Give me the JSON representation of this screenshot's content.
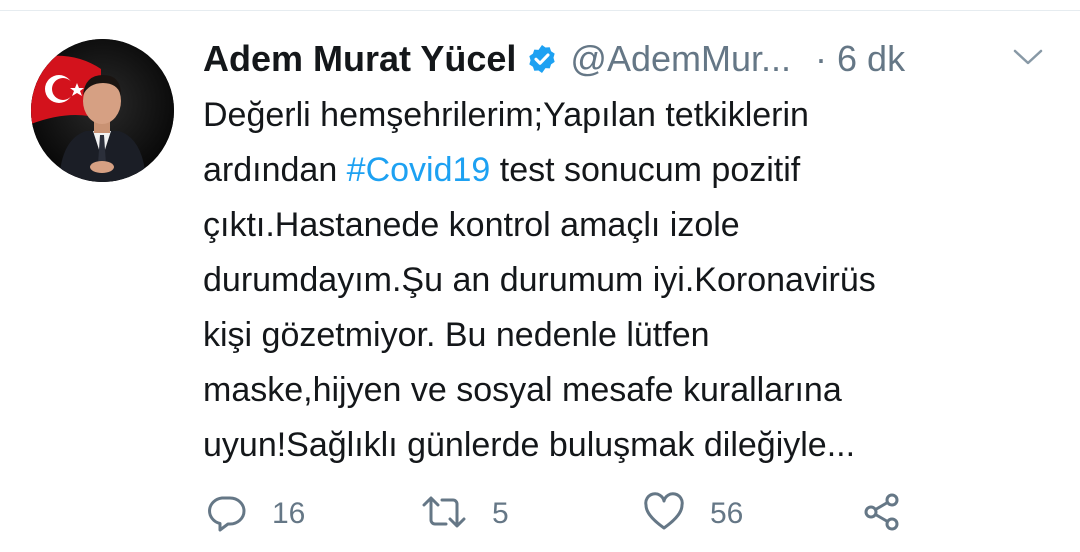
{
  "tweet": {
    "author_name": "Adem Murat Yücel",
    "handle": "@AdemMur...",
    "time": "· 6 dk",
    "verified_icon": "verified-badge-icon",
    "more_icon": "chevron-down-icon",
    "text_lines": [
      {
        "before": "Değerli hemşehrilerim;Yapılan tetkiklerin"
      },
      {
        "before": "ardından ",
        "hashtag": "#Covid19",
        "after": " test sonucum pozitif"
      },
      {
        "before": "çıktı.Hastanede kontrol amaçlı izole"
      },
      {
        "before": "durumdayım.Şu an durumum iyi.Koronavirüs"
      },
      {
        "before": "kişi gözetmiyor. Bu nedenle lütfen"
      },
      {
        "before": "maske,hijyen ve sosyal mesafe kurallarına"
      },
      {
        "before": "uyun!Sağlıklı günlerde buluşmak dileğiyle..."
      }
    ]
  },
  "actions": {
    "reply": {
      "icon": "reply-icon",
      "count": "16"
    },
    "retweet": {
      "icon": "retweet-icon",
      "count": "5"
    },
    "like": {
      "icon": "heart-icon",
      "count": "56"
    },
    "share": {
      "icon": "share-icon"
    }
  },
  "colors": {
    "text": "#14171a",
    "secondary": "#657786",
    "accent": "#1da1f2"
  }
}
